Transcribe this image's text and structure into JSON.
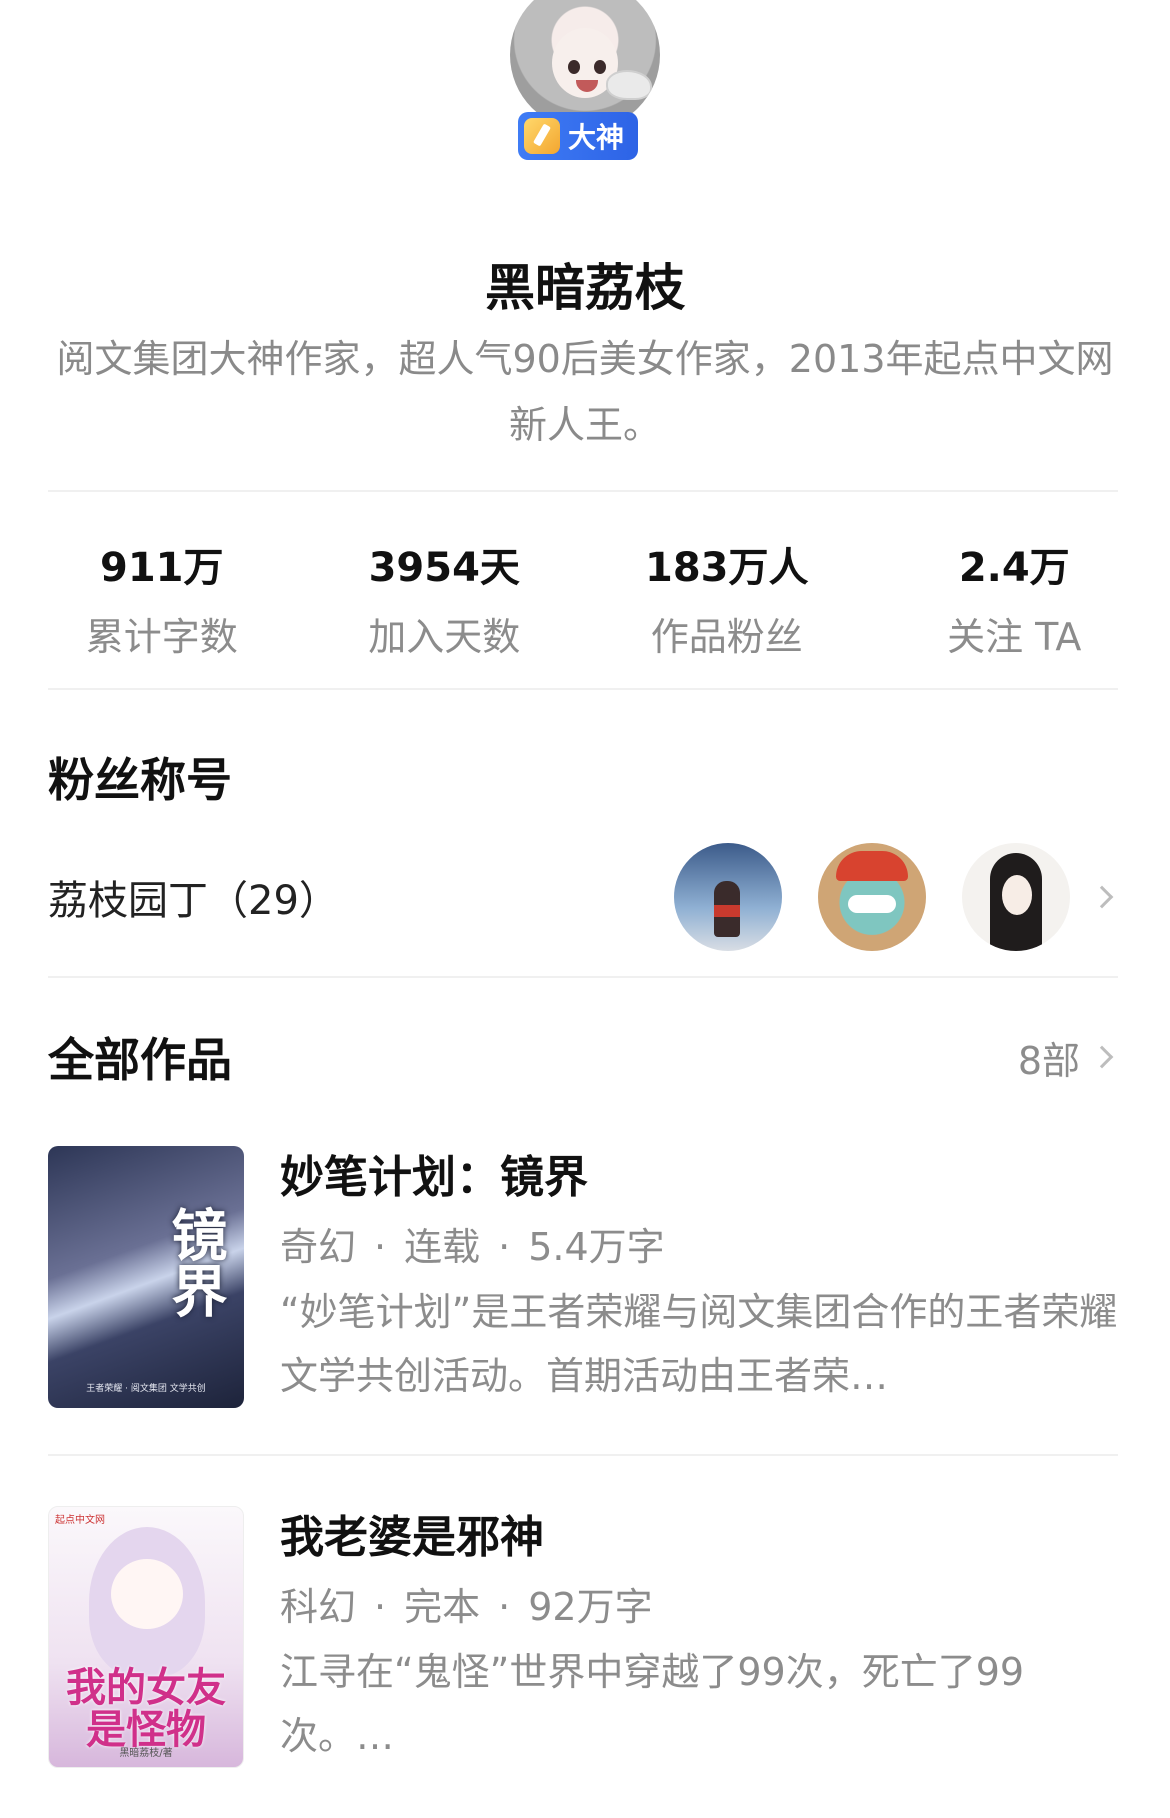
{
  "author": {
    "badge": "大神",
    "name": "黑暗荔枝",
    "bio": "阅文集团大神作家，超人气90后美女作家，2013年起点中文网新人王。"
  },
  "stats": [
    {
      "value": "911万",
      "label": "累计字数"
    },
    {
      "value": "3954天",
      "label": "加入天数"
    },
    {
      "value": "183万人",
      "label": "作品粉丝"
    },
    {
      "value": "2.4万",
      "label": "关注 TA"
    }
  ],
  "fans": {
    "title": "粉丝称号",
    "name": "荔枝园丁（29）"
  },
  "works": {
    "title": "全部作品",
    "count": "8部",
    "books": [
      {
        "title": "妙笔计划：镜界",
        "genre": "奇幻",
        "status": "连载",
        "words": "5.4万字",
        "desc": "“妙笔计划”是王者荣耀与阅文集团合作的王者荣耀文学共创活动。首期活动由王者荣…",
        "cover_title": "镜界",
        "cover_footer": "王者荣耀 · 阅文集团 文学共创"
      },
      {
        "title": "我老婆是邪神",
        "genre": "科幻",
        "status": "完本",
        "words": "92万字",
        "desc": "江寻在“鬼怪”世界中穿越了99次，死亡了99次。…",
        "cover_title": "我的女友是怪物",
        "cover_brand": "起点中文网",
        "cover_author": "黑暗荔枝/著"
      }
    ]
  },
  "colors": {
    "badge": "#2d63e6",
    "text_primary": "#111111",
    "text_secondary": "#8c8c8c",
    "divider": "#f0f0f0"
  },
  "icons": [
    "pen-icon",
    "chevron-right-icon"
  ]
}
